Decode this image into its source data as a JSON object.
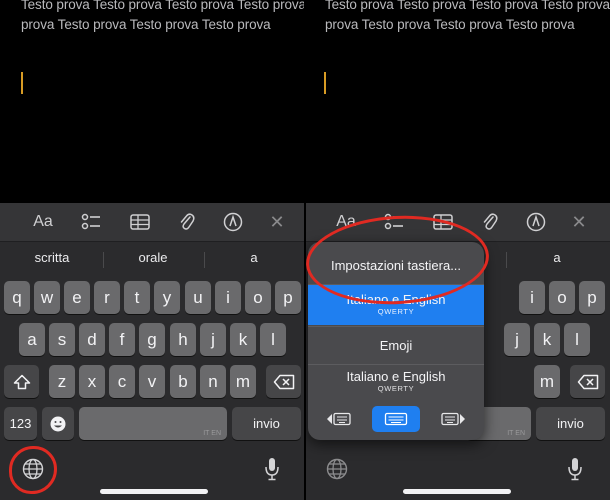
{
  "note_text": {
    "line1": "Testo prova Testo prova Testo prova Testo prova",
    "line2": "prova Testo prova Testo prova Testo prova"
  },
  "toolbar": {
    "format_label": "Aa",
    "icons": [
      "format-text-icon",
      "checklist-icon",
      "table-icon",
      "paperclip-icon",
      "markup-pen-icon",
      "close-icon"
    ]
  },
  "predictions": [
    "scritta",
    "orale",
    "a"
  ],
  "keyboard": {
    "row1": [
      "q",
      "w",
      "e",
      "r",
      "t",
      "y",
      "u",
      "i",
      "o",
      "p"
    ],
    "row2": [
      "a",
      "s",
      "d",
      "f",
      "g",
      "h",
      "j",
      "k",
      "l"
    ],
    "row3": [
      "z",
      "x",
      "c",
      "v",
      "b",
      "n",
      "m"
    ],
    "numbers_key": "123",
    "return_key": "invio",
    "space_hint": "IT EN"
  },
  "language_popup": {
    "items": [
      {
        "label": "Impostazioni tastiera...",
        "sub": ""
      },
      {
        "label": "Italiano e English",
        "sub": "QWERTY",
        "selected": true
      },
      {
        "label": "Emoji",
        "sub": ""
      },
      {
        "label": "Italiano e English",
        "sub": "QWERTY"
      }
    ],
    "layout_buttons": [
      "keyboard-left-icon",
      "keyboard-full-icon",
      "keyboard-right-icon"
    ],
    "selected_layout": "keyboard-full-icon"
  },
  "colors": {
    "cursor": "#d79b24",
    "highlight": "#1f7ff0",
    "annotation": "#e02a22"
  }
}
